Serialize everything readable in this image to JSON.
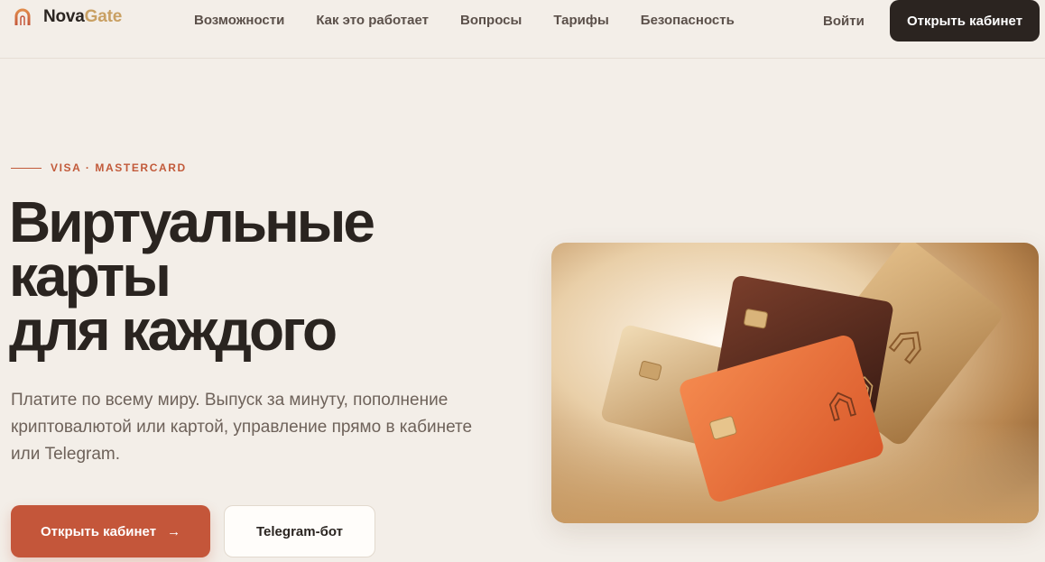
{
  "brand": {
    "name_part1": "Nova",
    "name_part2": "Gate",
    "logo_icon": "arch-icon"
  },
  "nav": {
    "items": [
      {
        "label": "Возможности"
      },
      {
        "label": "Как это работает"
      },
      {
        "label": "Вопросы"
      },
      {
        "label": "Тарифы"
      },
      {
        "label": "Безопасность"
      }
    ],
    "login_label": "Войти",
    "cta_label": "Открыть кабинет"
  },
  "hero": {
    "eyebrow": "VISA · MASTERCARD",
    "title_lines": [
      "Виртуальные",
      "карты",
      "для каждого"
    ],
    "lead": "Платите по всему миру. Выпуск за минуту, пополнение криптовалютой или картой, управление прямо в кабинете или Telegram.",
    "primary_button": "Открыть кабинет",
    "primary_button_icon": "arrow-right-icon",
    "secondary_button": "Telegram-бот"
  },
  "colors": {
    "background": "#f3eee8",
    "accent": "#c4563a",
    "dark": "#2b2420",
    "gold": "#c9a063"
  }
}
